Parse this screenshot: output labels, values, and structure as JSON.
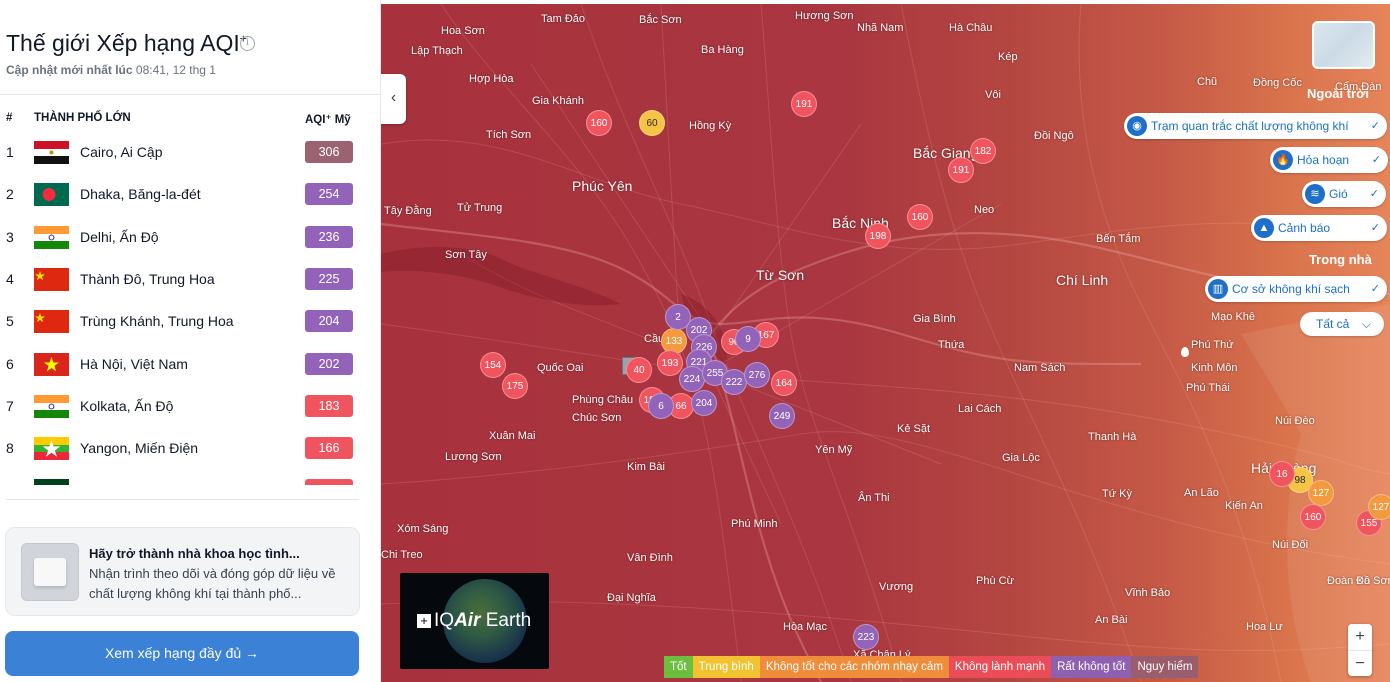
{
  "panel": {
    "title": "Thế giới Xếp hạng AQI",
    "title_sup": "+",
    "updated_label": "Cập nhật mới nhất lúc",
    "updated_time": "08:41, 12 thg 1",
    "col_rank": "#",
    "col_city": "THÀNH PHỐ LỚN",
    "col_aqi": "AQI⁺ Mỹ",
    "rows": [
      {
        "rank": "1",
        "city": "Cairo, Ai Cập",
        "aqi": "306",
        "color": "#9b6272",
        "flag": "egypt"
      },
      {
        "rank": "2",
        "city": "Dhaka, Băng-la-đét",
        "aqi": "254",
        "color": "#9263b8",
        "flag": "bangladesh"
      },
      {
        "rank": "3",
        "city": "Delhi, Ấn Độ",
        "aqi": "236",
        "color": "#9263b8",
        "flag": "india"
      },
      {
        "rank": "4",
        "city": "Thành Đô, Trung Hoa",
        "aqi": "225",
        "color": "#9263b8",
        "flag": "china"
      },
      {
        "rank": "5",
        "city": "Trùng Khánh, Trung Hoa",
        "aqi": "204",
        "color": "#9263b8",
        "flag": "china"
      },
      {
        "rank": "6",
        "city": "Hà Nội, Việt Nam",
        "aqi": "202",
        "color": "#9263b8",
        "flag": "vietnam"
      },
      {
        "rank": "7",
        "city": "Kolkata, Ấn Độ",
        "aqi": "183",
        "color": "#f0555f",
        "flag": "india"
      },
      {
        "rank": "8",
        "city": "Yangon, Miến Điện",
        "aqi": "166",
        "color": "#f0555f",
        "flag": "myanmar"
      }
    ],
    "promo_title": "Hãy trở thành nhà khoa học tình...",
    "promo_text": "Nhận trình theo dõi và đóng góp dữ liệu về chất lượng không khí tại thành phố...",
    "cta_label": "Xem xếp hạng đầy đủ →"
  },
  "map": {
    "collapse_icon": "chevron-left-icon",
    "places": [
      {
        "name": "Tam Đảo",
        "size": "s"
      },
      {
        "name": "Bắc Sơn",
        "size": "s"
      },
      {
        "name": "Hương Sơn",
        "size": "s"
      },
      {
        "name": "Hoa Sơn",
        "size": "s"
      },
      {
        "name": "Nhã Nam",
        "size": "s"
      },
      {
        "name": "Hà Châu",
        "size": "s"
      },
      {
        "name": "Lập Thạch",
        "size": "s"
      },
      {
        "name": "Ba Hàng",
        "size": "s"
      },
      {
        "name": "Kép",
        "size": "s"
      },
      {
        "name": "Hợp Hòa",
        "size": "s"
      },
      {
        "name": "Chũ",
        "size": "s"
      },
      {
        "name": "Đồng Cốc",
        "size": "s"
      },
      {
        "name": "Cẩm Đàn",
        "size": "s"
      },
      {
        "name": "Gia Khánh",
        "size": "s"
      },
      {
        "name": "Vôi",
        "size": "s"
      },
      {
        "name": "Hồng Kỳ",
        "size": "s"
      },
      {
        "name": "Tích Sơn",
        "size": "s"
      },
      {
        "name": "Đồi Ngô",
        "size": "s"
      },
      {
        "name": "Bắc Giang",
        "size": "b"
      },
      {
        "name": "Phúc Yên",
        "size": "b"
      },
      {
        "name": "Tây Đằng",
        "size": "s"
      },
      {
        "name": "Tử Trung",
        "size": "s"
      },
      {
        "name": "Neo",
        "size": "s"
      },
      {
        "name": "Bắc Ninh",
        "size": "b"
      },
      {
        "name": "Bến Tắm",
        "size": "s"
      },
      {
        "name": "Sơn Tây",
        "size": "s"
      },
      {
        "name": "Từ Sơn",
        "size": "b"
      },
      {
        "name": "Chí Linh",
        "size": "b"
      },
      {
        "name": "Gia Bình",
        "size": "s"
      },
      {
        "name": "Mạo Khê",
        "size": "s"
      },
      {
        "name": "Thứa",
        "size": "s"
      },
      {
        "name": "Phú Thứ",
        "size": "s"
      },
      {
        "name": "Quốc Oai",
        "size": "s"
      },
      {
        "name": "Cầu",
        "size": "s"
      },
      {
        "name": "Nam Sách",
        "size": "s"
      },
      {
        "name": "Kinh Môn",
        "size": "s"
      },
      {
        "name": "Phú Thái",
        "size": "s"
      },
      {
        "name": "Phùng Châu",
        "size": "s"
      },
      {
        "name": "Chúc Sơn",
        "size": "s"
      },
      {
        "name": "Lai Cách",
        "size": "s"
      },
      {
        "name": "Kẻ Sặt",
        "size": "s"
      },
      {
        "name": "Núi Đèo",
        "size": "s"
      },
      {
        "name": "Xuân Mai",
        "size": "s"
      },
      {
        "name": "Thanh Hà",
        "size": "s"
      },
      {
        "name": "Lương Sơn",
        "size": "s"
      },
      {
        "name": "Yên Mỹ",
        "size": "s"
      },
      {
        "name": "Gia Lộc",
        "size": "s"
      },
      {
        "name": "Hải Phòng",
        "size": "b"
      },
      {
        "name": "Kim Bài",
        "size": "s"
      },
      {
        "name": "Ân Thi",
        "size": "s"
      },
      {
        "name": "Tứ Kỳ",
        "size": "s"
      },
      {
        "name": "An Lão",
        "size": "s"
      },
      {
        "name": "Kiến An",
        "size": "s"
      },
      {
        "name": "Phú Minh",
        "size": "s"
      },
      {
        "name": "Xóm Sáng",
        "size": "s"
      },
      {
        "name": "Núi Đối",
        "size": "s"
      },
      {
        "name": "Chi Treo",
        "size": "s"
      },
      {
        "name": "Vân Đình",
        "size": "s"
      },
      {
        "name": "Phù Cừ",
        "size": "s"
      },
      {
        "name": "Đoàn Xá",
        "size": "s"
      },
      {
        "name": "Đồ Sơn",
        "size": "s"
      },
      {
        "name": "Đại Nghĩa",
        "size": "s"
      },
      {
        "name": "Vương",
        "size": "s"
      },
      {
        "name": "Vĩnh Bảo",
        "size": "s"
      },
      {
        "name": "Hòa Mạc",
        "size": "s"
      },
      {
        "name": "An Bài",
        "size": "s"
      },
      {
        "name": "Thanh Hà",
        "size": "s"
      },
      {
        "name": "Xã Chân Lý",
        "size": "s"
      },
      {
        "name": "Hoa Lư",
        "size": "s"
      }
    ],
    "markers": [
      {
        "value": "160",
        "color": "#f0555f"
      },
      {
        "value": "60",
        "color": "#f6c343"
      },
      {
        "value": "191",
        "color": "#f0555f"
      },
      {
        "value": "182",
        "color": "#f0555f"
      },
      {
        "value": "191",
        "color": "#f0555f"
      },
      {
        "value": "160",
        "color": "#f0555f"
      },
      {
        "value": "198",
        "color": "#f0555f"
      },
      {
        "value": "202",
        "color": "#9263b8"
      },
      {
        "value": "133",
        "color": "#f39a3f"
      },
      {
        "value": "226",
        "color": "#9263b8"
      },
      {
        "value": "90",
        "color": "#f0555f"
      },
      {
        "value": "167",
        "color": "#f0555f"
      },
      {
        "value": "193",
        "color": "#f0555f"
      },
      {
        "value": "221",
        "color": "#9263b8"
      },
      {
        "value": "224",
        "color": "#9263b8"
      },
      {
        "value": "255",
        "color": "#9263b8"
      },
      {
        "value": "222",
        "color": "#9263b8"
      },
      {
        "value": "276",
        "color": "#9263b8"
      },
      {
        "value": "164",
        "color": "#f0555f"
      },
      {
        "value": "154",
        "color": "#f0555f"
      },
      {
        "value": "175",
        "color": "#f0555f"
      },
      {
        "value": "192",
        "color": "#f0555f"
      },
      {
        "value": "66",
        "color": "#f0555f"
      },
      {
        "value": "204",
        "color": "#9263b8"
      },
      {
        "value": "249",
        "color": "#9263b8"
      },
      {
        "value": "223",
        "color": "#9263b8"
      },
      {
        "value": "98",
        "color": "#f6c343"
      },
      {
        "value": "127",
        "color": "#f39a3f"
      },
      {
        "value": "160",
        "color": "#f0555f"
      },
      {
        "value": "155",
        "color": "#f0555f"
      },
      {
        "value": "127",
        "color": "#f39a3f"
      },
      {
        "value": "16",
        "color": "#f0555f"
      },
      {
        "value": "40",
        "color": "#f0555f"
      },
      {
        "value": "6",
        "color": "#9263b8"
      },
      {
        "value": "2",
        "color": "#9263b8"
      },
      {
        "value": "9",
        "color": "#9263b8"
      }
    ],
    "outdoor_label": "Ngoài trời",
    "indoor_label": "Trong nhà",
    "layers": [
      {
        "label": "Trạm quan trắc chất lượng không khí",
        "icon": "station-icon",
        "glyph": "◉"
      },
      {
        "label": "Hỏa hoạn",
        "icon": "fire-icon",
        "glyph": "🔥"
      },
      {
        "label": "Gió",
        "icon": "wind-icon",
        "glyph": "≋"
      },
      {
        "label": "Cảnh báo",
        "icon": "alert-icon",
        "glyph": "▲"
      },
      {
        "label": "Cơ sở không khí sạch",
        "icon": "building-icon",
        "glyph": "▥"
      }
    ],
    "check": "✓",
    "dropdown_label": "Tất cả",
    "dropdown_chev": "⌵",
    "earth_prefix": "IQ",
    "earth_brand": "Air",
    "earth_suffix": " Earth",
    "zoom_in": "+",
    "zoom_out": "−",
    "legend": [
      {
        "label": "Tốt",
        "color": "#6bbf3c"
      },
      {
        "label": "Trung bình",
        "color": "#f2c230"
      },
      {
        "label": "Không tốt cho các nhóm nhạy cảm",
        "color": "#f08d3a"
      },
      {
        "label": "Không lành mạnh",
        "color": "#ea4d57"
      },
      {
        "label": "Rất không tốt",
        "color": "#8f5fb0"
      },
      {
        "label": "Nguy hiểm",
        "color": "#9a5d6c"
      }
    ]
  }
}
